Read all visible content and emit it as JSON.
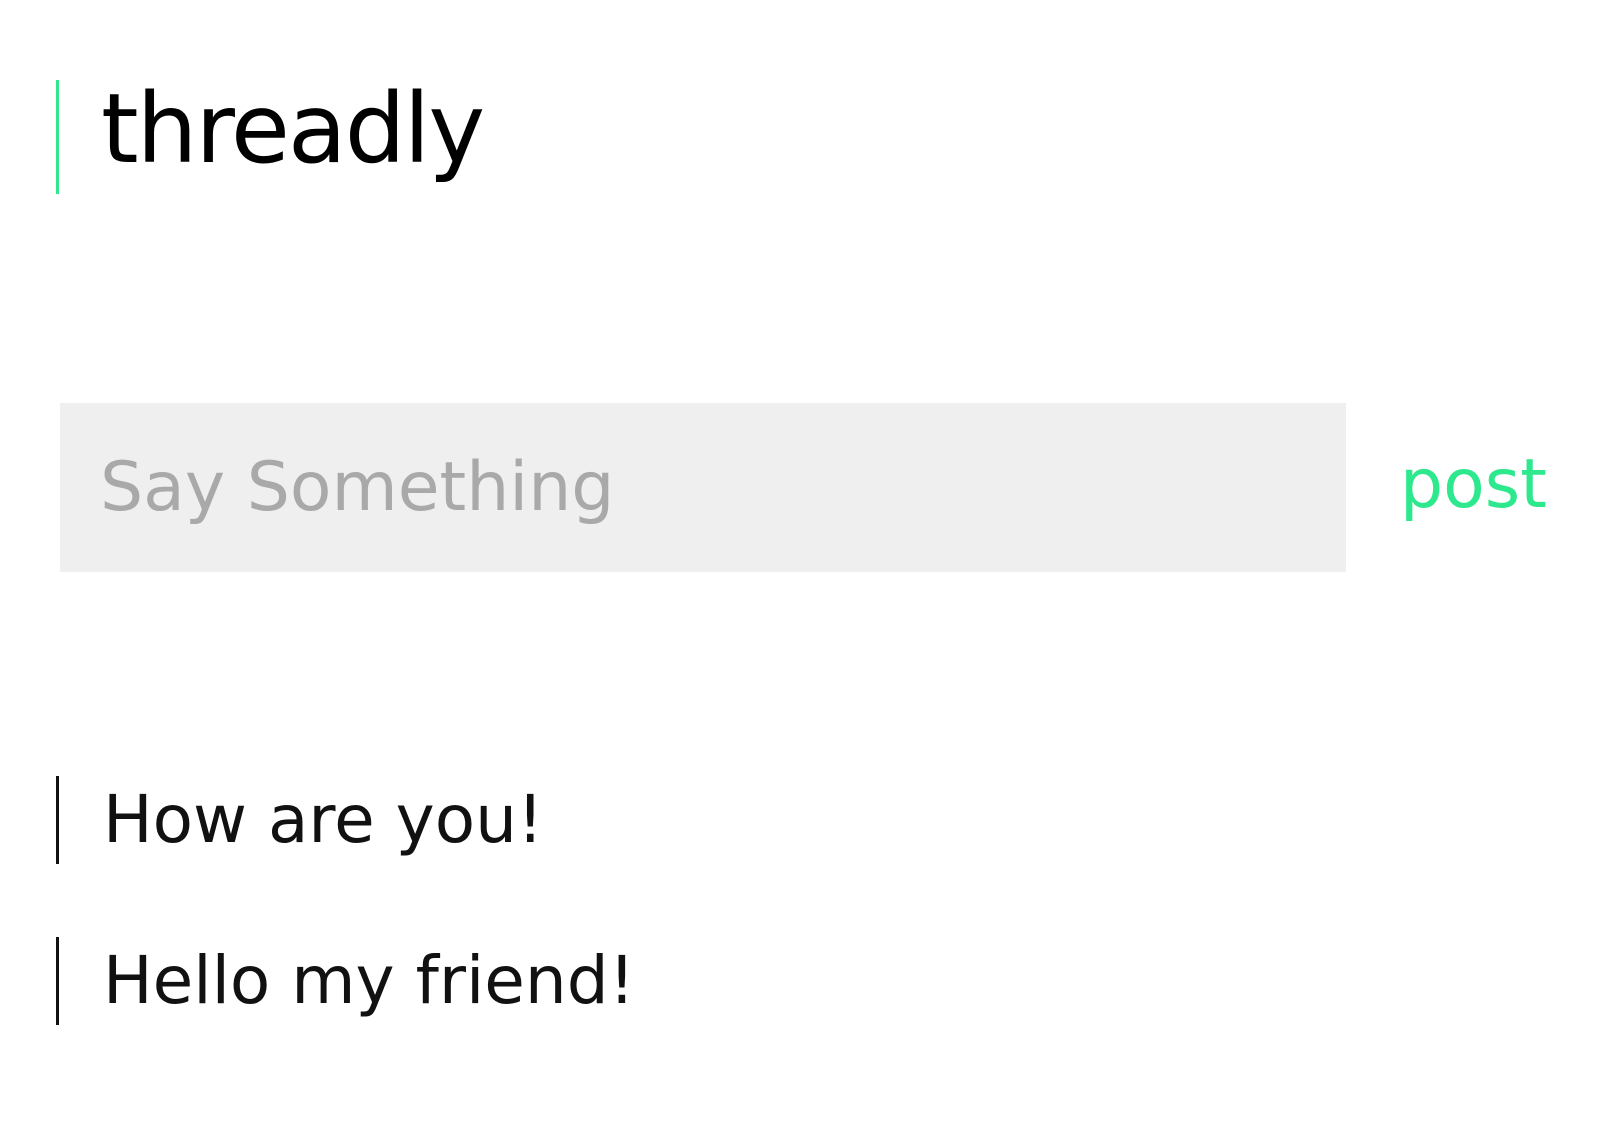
{
  "app": {
    "title": "threadly"
  },
  "composer": {
    "placeholder": "Say Something",
    "value": "",
    "post_label": "post"
  },
  "threads": [
    {
      "text": "How are you!"
    },
    {
      "text": "Hello my friend!"
    }
  ],
  "colors": {
    "accent": "#2de88c",
    "input_background": "#efefef",
    "placeholder": "#a9a9a9",
    "text": "#111111"
  }
}
